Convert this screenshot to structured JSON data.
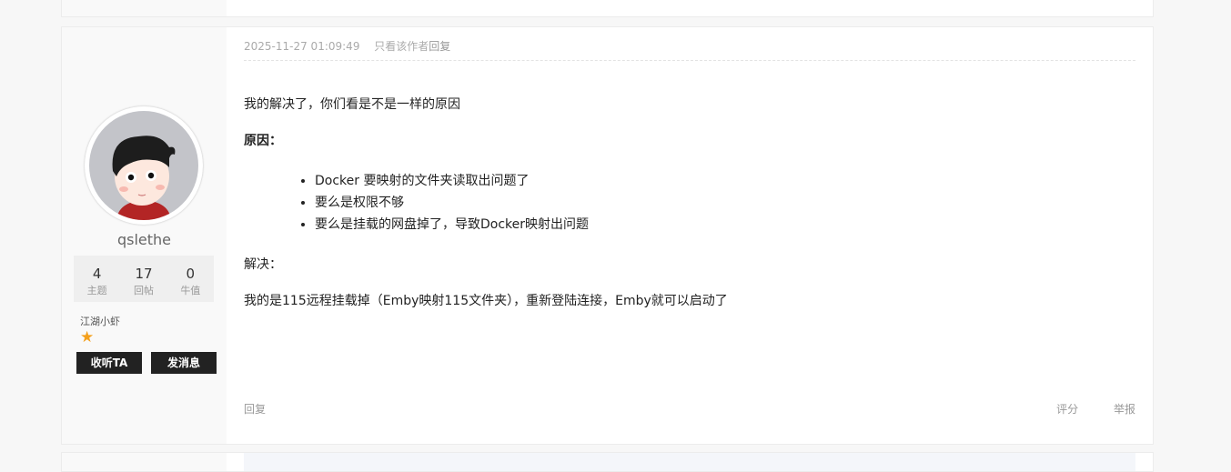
{
  "post": {
    "timestamp": "2025-11-27 01:09:49",
    "only_author": "只看该作者",
    "reply_link": "回复",
    "content": {
      "p1": "我的解决了，你们看是不是一样的原因",
      "reason_heading": "原因：",
      "reasons": [
        "Docker 要映射的文件夹读取出问题了",
        "要么是权限不够",
        "要么是挂载的网盘掉了，导致Docker映射出问题"
      ],
      "solution_heading": "解决：",
      "solution": "我的是115远程挂载掉（Emby映射115文件夹），重新登陆连接，Emby就可以启动了"
    },
    "footer": {
      "reply": "回复",
      "rate": "评分",
      "report": "举报"
    }
  },
  "author": {
    "username": "qslethe",
    "stats": [
      {
        "num": "4",
        "label": "主题"
      },
      {
        "num": "17",
        "label": "回帖"
      },
      {
        "num": "0",
        "label": "牛值"
      }
    ],
    "rank": "江湖小虾",
    "star_icon": "★",
    "follow_button": "收听TA",
    "message_button": "发消息"
  },
  "colors": {
    "accent_star": "#f4a01c",
    "button_bg": "#222222"
  }
}
